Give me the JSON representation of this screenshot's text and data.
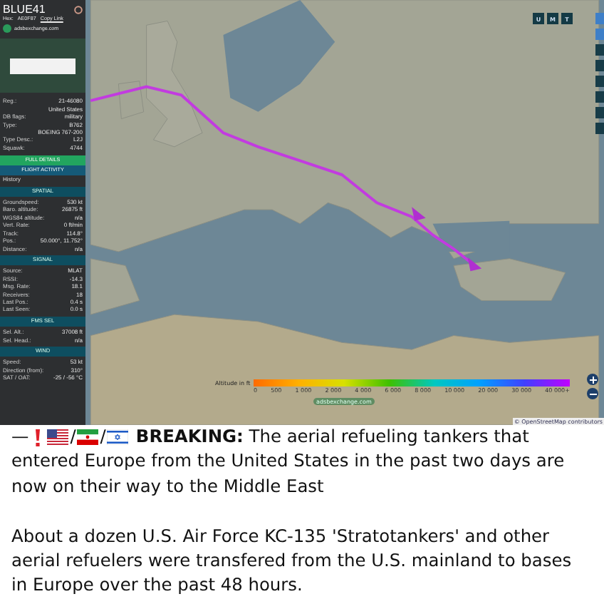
{
  "panel": {
    "callsign": "BLUE41",
    "hex_label": "Hex:",
    "hex": "AE0F87",
    "copy_link": "Copy Link",
    "site": "adsbexchange.com",
    "info": [
      {
        "label": "Reg.:",
        "value": "21-46080"
      },
      {
        "value": "United States"
      },
      {
        "label": "DB flags:",
        "value": "military"
      },
      {
        "label": "Type:",
        "value": "B762"
      },
      {
        "value": "BOEING 767-200"
      },
      {
        "label": "Type Desc.:",
        "value": "L2J"
      },
      {
        "label": "Squawk:",
        "value": "4744"
      }
    ],
    "actions": [
      {
        "label": "FULL DETAILS",
        "kind": "details"
      },
      {
        "label": "FLIGHT ACTIVITY",
        "kind": "activity"
      }
    ],
    "history": "History",
    "sections": [
      {
        "title": "SPATIAL",
        "rows": [
          {
            "label": "Groundspeed:",
            "value": "530 kt"
          },
          {
            "label": "Baro. altitude:",
            "value": "26875 ft"
          },
          {
            "label": "WGS84 altitude:",
            "value": "n/a"
          },
          {
            "label": "Vert. Rate:",
            "value": "0 ft/min"
          },
          {
            "label": "Track:",
            "value": "114.8°"
          },
          {
            "label": "Pos.:",
            "value": "50.000°, 11.752°"
          },
          {
            "label": "Distance:",
            "value": "n/a"
          }
        ]
      },
      {
        "title": "SIGNAL",
        "rows": [
          {
            "label": "Source:",
            "value": "MLAT"
          },
          {
            "label": "RSSI:",
            "value": "-14.3"
          },
          {
            "label": "Msg. Rate:",
            "value": "18.1"
          },
          {
            "label": "Receivers:",
            "value": "18"
          },
          {
            "label": "Last Pos.:",
            "value": "0.4 s"
          },
          {
            "label": "Last Seen:",
            "value": "0.0 s"
          }
        ]
      },
      {
        "title": "FMS SEL",
        "rows": [
          {
            "label": "Sel. Alt.:",
            "value": "37008 ft"
          },
          {
            "label": "Sel. Head.:",
            "value": "n/a"
          }
        ]
      },
      {
        "title": "WIND",
        "rows": [
          {
            "label": "Speed:",
            "value": "53 kt"
          },
          {
            "label": "Direction (from):",
            "value": "310°"
          },
          {
            "label": "SAT / OAT:",
            "value": "-25 / -56 °C"
          }
        ]
      }
    ]
  },
  "map": {
    "layer_buttons": [
      "U",
      "M",
      "T"
    ],
    "legend": {
      "title": "Altitude in ft",
      "ticks": [
        "0",
        "500",
        "1 000",
        "2 000",
        "4 000",
        "6 000",
        "8 000",
        "10 000",
        "20 000",
        "30 000",
        "40 000+"
      ]
    },
    "logo": "adsbexchange.com",
    "attribution": "© OpenStreetMap contributors"
  },
  "post": {
    "dash": "—",
    "flags": [
      {
        "kind": "us"
      },
      {
        "kind": "iran"
      },
      {
        "kind": "israel"
      }
    ],
    "separators": [
      "/",
      "/"
    ],
    "lead": "**BREAKING:** The aerial refueling tankers that",
    "lead_rest": "entered Europe from the United States in the past two days are now on their way to the Middle East",
    "body": "About a dozen U.S. Air Force KC-135 'Stratotankers' and other aerial refuelers were transfered from the U.S. mainland to bases in Europe over the past 48 hours."
  }
}
